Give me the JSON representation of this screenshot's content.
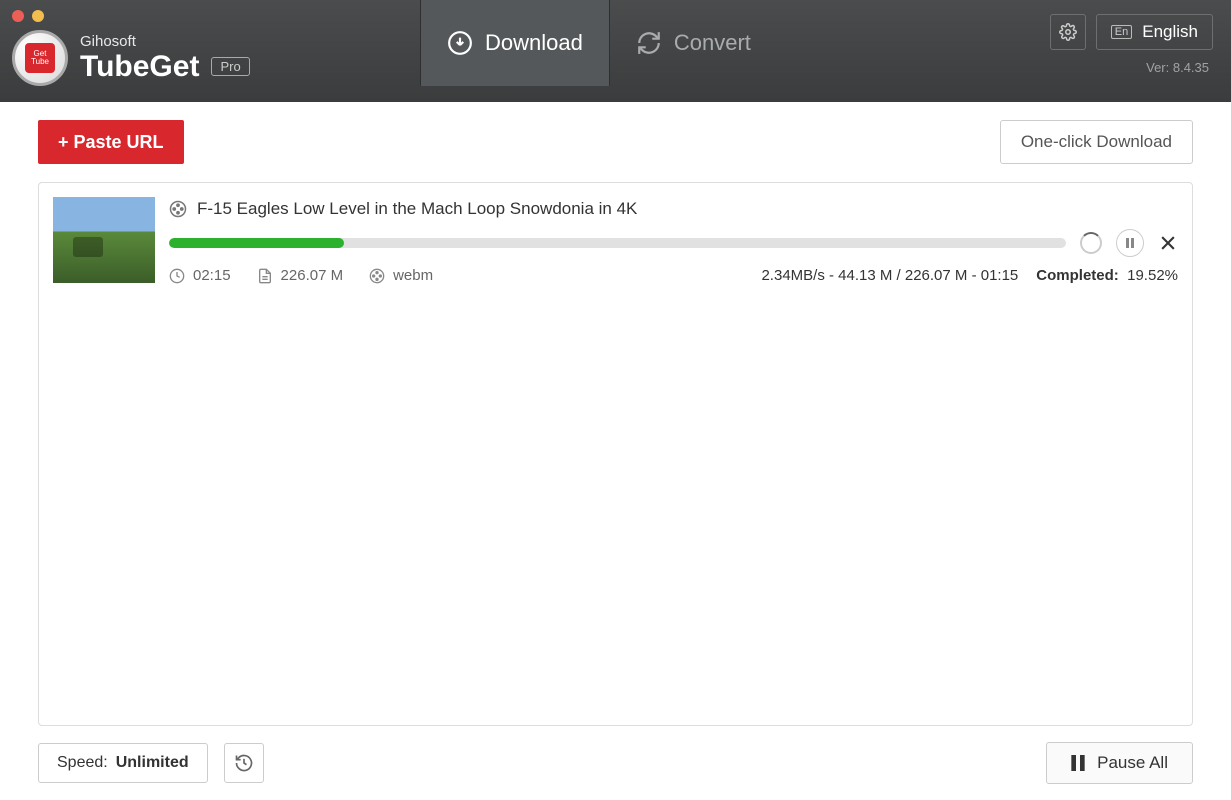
{
  "brand": {
    "company": "Gihosoft",
    "app": "TubeGet",
    "tier": "Pro"
  },
  "tabs": {
    "download": "Download",
    "convert": "Convert"
  },
  "header": {
    "language": "English",
    "lang_code": "En",
    "version": "Ver: 8.4.35"
  },
  "toolbar": {
    "paste": "+ Paste URL",
    "oneclick": "One-click Download"
  },
  "items": [
    {
      "title": "F-15 Eagles Low Level in the Mach Loop Snowdonia in 4K",
      "duration": "02:15",
      "size": "226.07 M",
      "format": "webm",
      "progress_pct": 19.52,
      "stats": "2.34MB/s - 44.13 M / 226.07 M - 01:15",
      "completed_label": "Completed:",
      "completed_value": "19.52%"
    }
  ],
  "footer": {
    "speed_label": "Speed:",
    "speed_value": "Unlimited",
    "pause_all": "Pause All"
  }
}
